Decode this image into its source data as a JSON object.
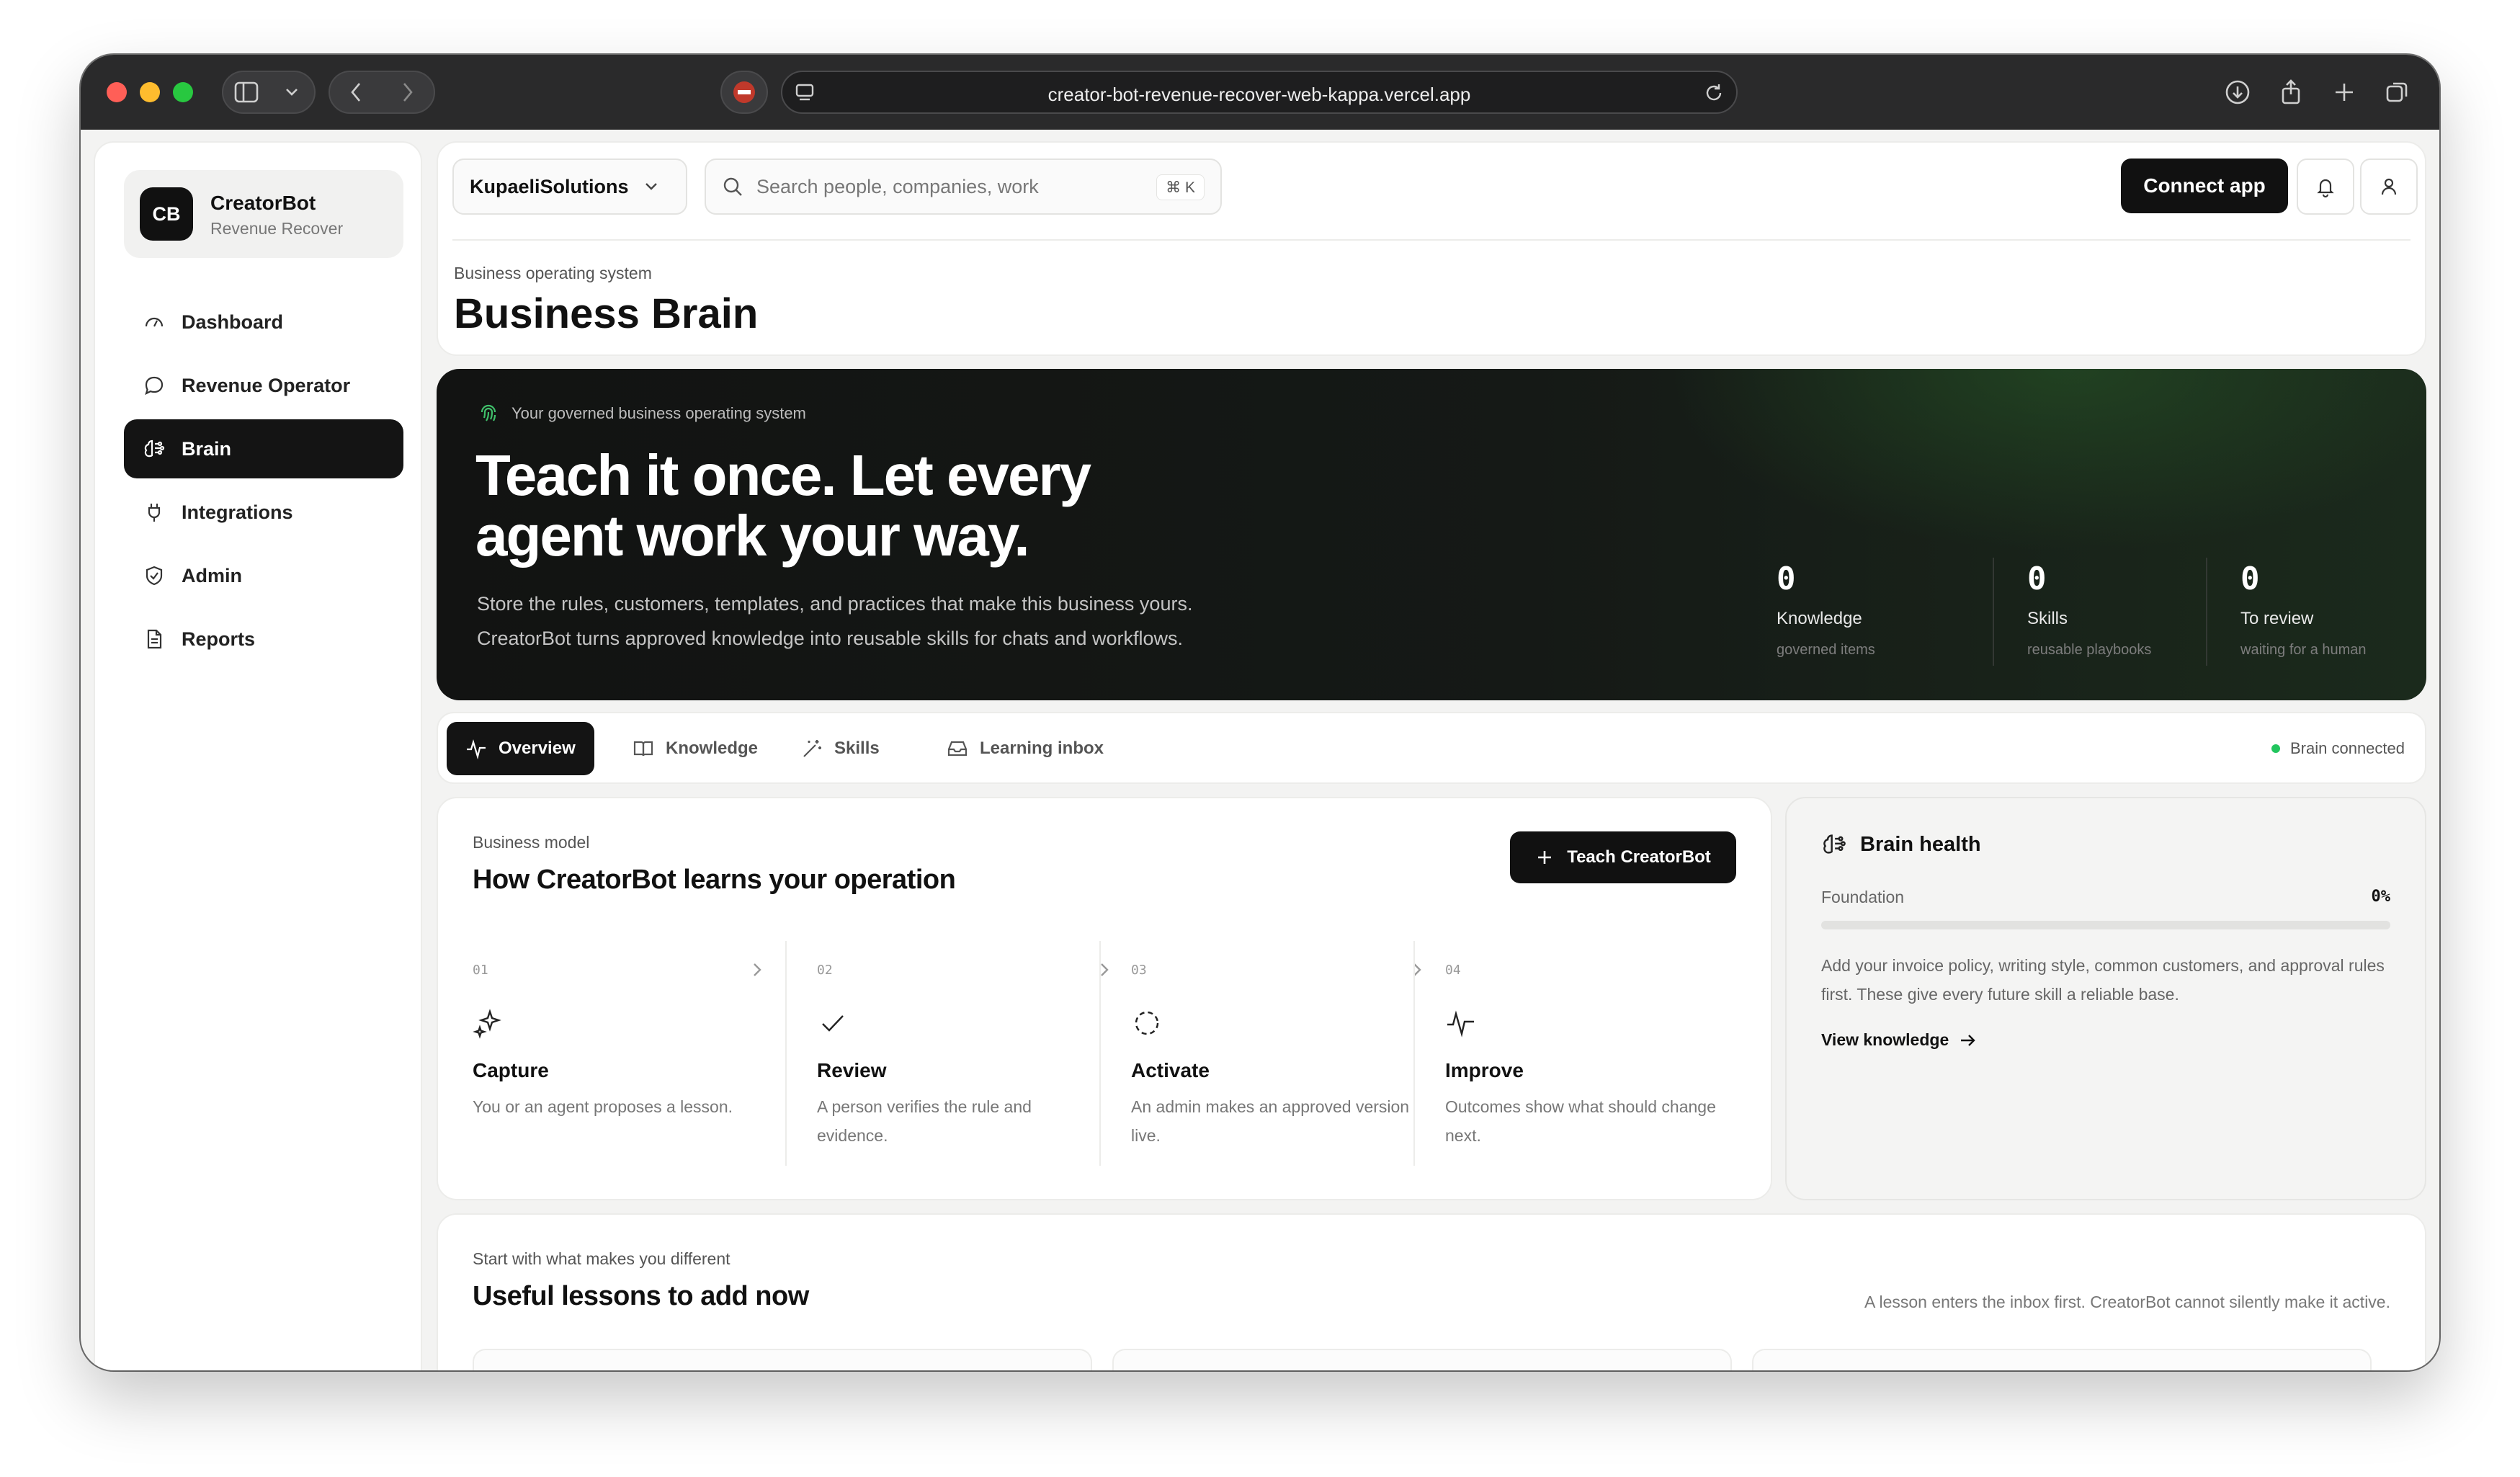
{
  "browser": {
    "url": "creator-bot-revenue-recover-web-kappa.vercel.app"
  },
  "brand": {
    "initials": "CB",
    "name": "CreatorBot",
    "subtitle": "Revenue Recover"
  },
  "sidebar": {
    "items": [
      {
        "label": "Dashboard",
        "icon": "gauge-icon",
        "active": false
      },
      {
        "label": "Revenue Operator",
        "icon": "chat-icon",
        "active": false
      },
      {
        "label": "Brain",
        "icon": "brain-icon",
        "active": true
      },
      {
        "label": "Integrations",
        "icon": "plug-icon",
        "active": false
      },
      {
        "label": "Admin",
        "icon": "shield-check-icon",
        "active": false
      },
      {
        "label": "Reports",
        "icon": "document-icon",
        "active": false
      }
    ]
  },
  "header": {
    "workspace": "KupaeliSolutions",
    "search_placeholder": "Search people, companies, work",
    "search_shortcut": "⌘ K",
    "connect_label": "Connect app",
    "eyebrow": "Business operating system",
    "title": "Business Brain"
  },
  "hero": {
    "eyebrow": "Your governed business operating system",
    "title": "Teach it once. Let every agent work your way.",
    "description_line1": "Store the rules, customers, templates, and practices that make this business yours.",
    "description_line2": "CreatorBot turns approved knowledge into reusable skills for chats and workflows.",
    "stats": [
      {
        "value": "0",
        "label": "Knowledge",
        "sub": "governed items"
      },
      {
        "value": "0",
        "label": "Skills",
        "sub": "reusable playbooks"
      },
      {
        "value": "0",
        "label": "To review",
        "sub": "waiting for a human"
      }
    ]
  },
  "tabs": {
    "items": [
      {
        "label": "Overview",
        "icon": "pulse-icon",
        "active": true
      },
      {
        "label": "Knowledge",
        "icon": "book-icon",
        "active": false
      },
      {
        "label": "Skills",
        "icon": "wand-icon",
        "active": false
      },
      {
        "label": "Learning inbox",
        "icon": "inbox-icon",
        "active": false
      }
    ],
    "status": "Brain connected",
    "status_color": "#22c55e"
  },
  "model": {
    "eyebrow": "Business model",
    "title": "How CreatorBot learns your operation",
    "teach_label": "Teach CreatorBot",
    "steps": [
      {
        "num": "01",
        "title": "Capture",
        "desc": "You or an agent proposes a lesson.",
        "icon": "sparkle-icon"
      },
      {
        "num": "02",
        "title": "Review",
        "desc": "A person verifies the rule and evidence.",
        "icon": "check-icon"
      },
      {
        "num": "03",
        "title": "Activate",
        "desc": "An admin makes an approved version live.",
        "icon": "dashed-circle-icon"
      },
      {
        "num": "04",
        "title": "Improve",
        "desc": "Outcomes show what should change next.",
        "icon": "pulse-icon"
      }
    ]
  },
  "health": {
    "title": "Brain health",
    "foundation_label": "Foundation",
    "foundation_pct": "0%",
    "foundation_value": 0,
    "description": "Add your invoice policy, writing style, common customers, and approval rules first. These give every future skill a reliable base.",
    "link_label": "View knowledge"
  },
  "lessons": {
    "eyebrow": "Start with what makes you different",
    "title": "Useful lessons to add now",
    "note": "A lesson enters the inbox first. CreatorBot cannot silently make it active."
  }
}
